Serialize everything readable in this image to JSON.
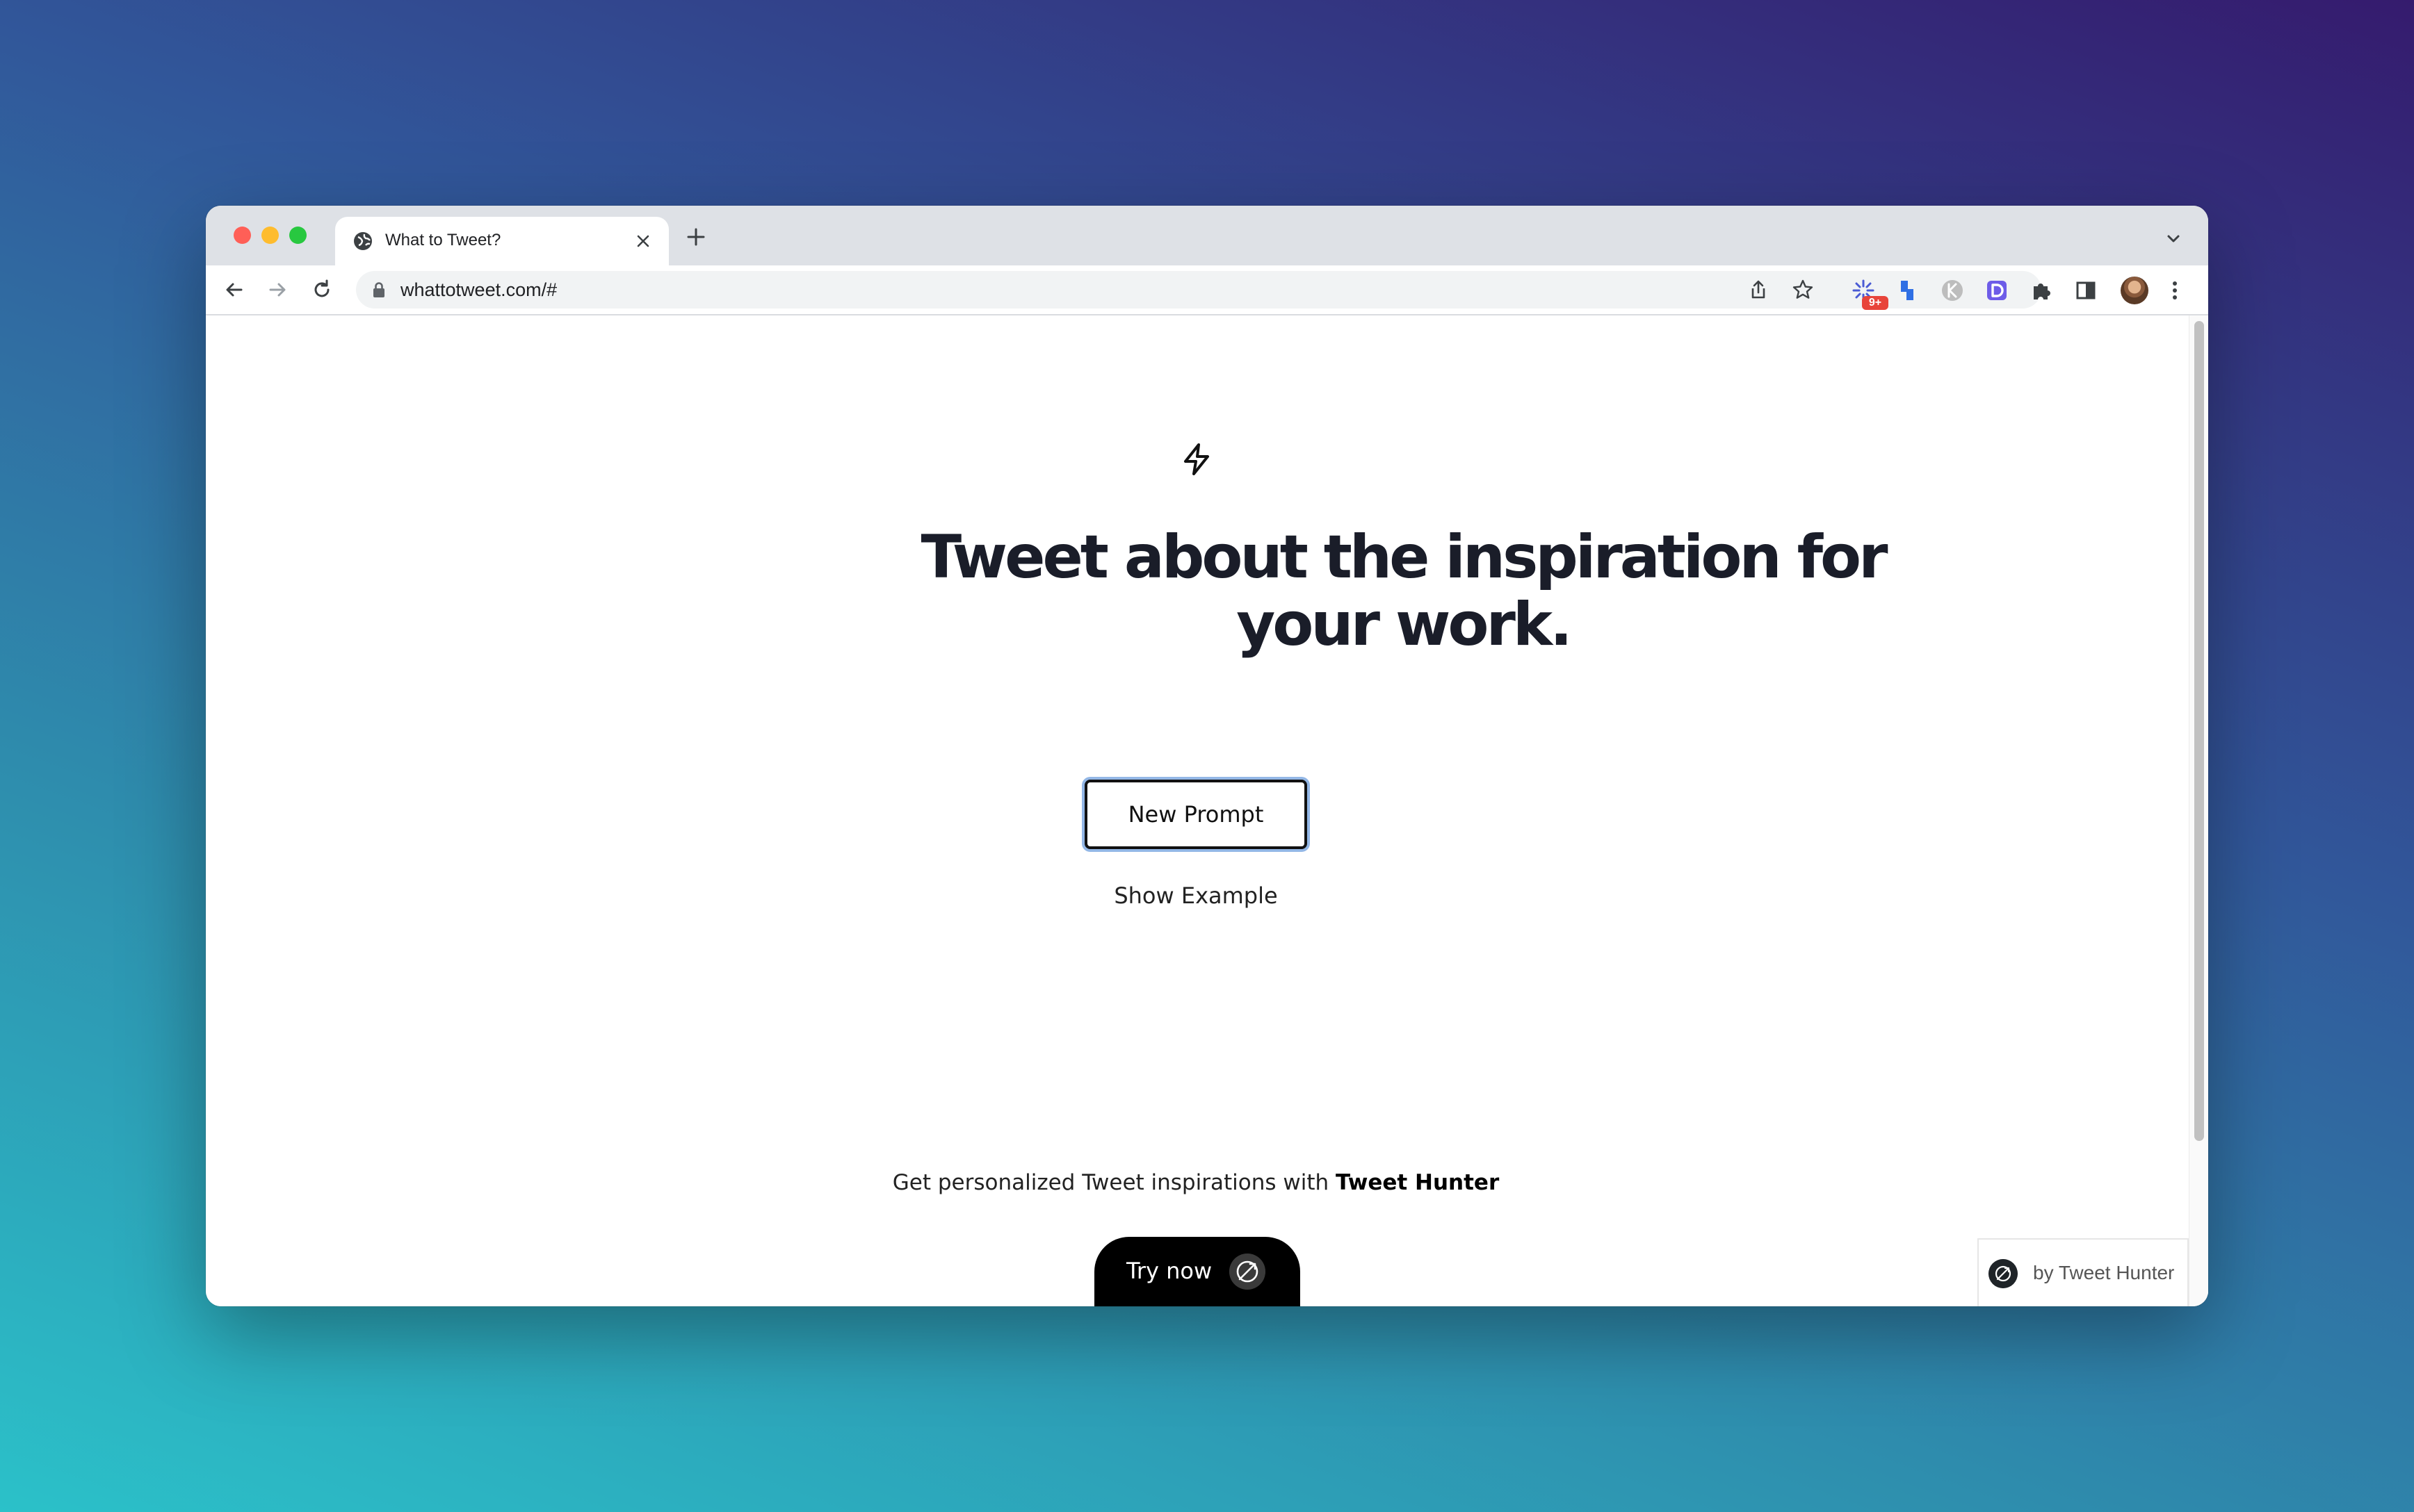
{
  "browser": {
    "tab": {
      "title": "What to Tweet?",
      "favicon": "globe-icon"
    },
    "address_bar": {
      "url": "whattotweet.com/#"
    },
    "extensions": {
      "badge_count": "9+"
    },
    "colors": {
      "traffic_red": "#ff5f57",
      "traffic_yellow": "#febc2e",
      "traffic_green": "#28c840"
    }
  },
  "page": {
    "icon": "lightning-bolt-icon",
    "headline": "Tweet about the inspiration for your work.",
    "new_prompt_label": "New Prompt",
    "show_example_label": "Show Example",
    "promo": {
      "text": "Get personalized Tweet inspirations with ",
      "brand": "Tweet Hunter"
    },
    "try_now_label": "Try now",
    "attribution_label": "by Tweet Hunter"
  }
}
